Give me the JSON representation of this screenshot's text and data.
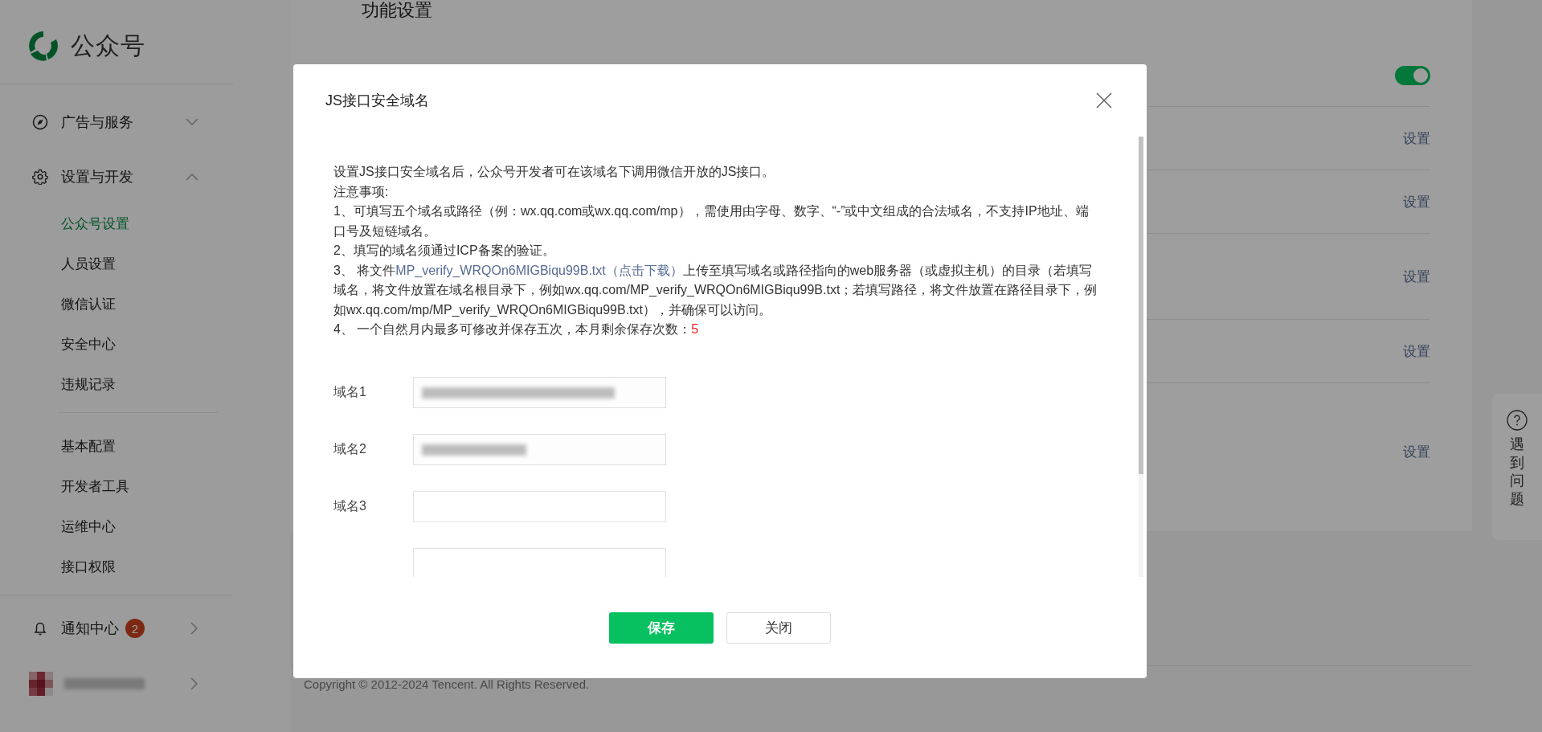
{
  "sidebar": {
    "brand": "公众号",
    "menus": [
      {
        "label": "广告与服务",
        "kind": "compass",
        "expanded": false
      },
      {
        "label": "设置与开发",
        "kind": "gear",
        "expanded": true,
        "groups": [
          {
            "items": [
              {
                "label": "公众号设置",
                "selected": true
              },
              {
                "label": "人员设置",
                "selected": false
              },
              {
                "label": "微信认证",
                "selected": false
              },
              {
                "label": "安全中心",
                "selected": false
              },
              {
                "label": "违规记录",
                "selected": false
              }
            ]
          },
          {
            "items": [
              {
                "label": "基本配置",
                "selected": false
              },
              {
                "label": "开发者工具",
                "selected": false
              },
              {
                "label": "运维中心",
                "selected": false
              },
              {
                "label": "接口权限",
                "selected": false
              }
            ]
          }
        ]
      }
    ],
    "notification": {
      "label": "通知中心",
      "badge": "2"
    }
  },
  "main": {
    "title": "功能设置",
    "rows": [
      {
        "kind": "toggle",
        "on": true
      },
      {
        "kind": "link",
        "label": "设置"
      },
      {
        "kind": "link",
        "label": "设置"
      },
      {
        "kind": "link",
        "label": "设置"
      },
      {
        "kind": "link",
        "label": "设置"
      },
      {
        "kind": "link",
        "label": "设置"
      }
    ],
    "footer": "Copyright © 2012-2024 Tencent. All Rights Reserved."
  },
  "help": {
    "label": "遇到问题"
  },
  "dialog": {
    "title": "JS接口安全域名",
    "intro": "设置JS接口安全域名后，公众号开发者可在该域名下调用微信开放的JS接口。",
    "notes_title": "注意事项:",
    "notes": [
      {
        "kind": "plain",
        "text": "1、可填写五个域名或路径（例：wx.qq.com或wx.qq.com/mp），需使用由字母、数字、“-”或中文组成的合法域名，不支持IP地址、端口号及短链域名。"
      },
      {
        "kind": "plain",
        "text": "2、填写的域名须通过ICP备案的验证。"
      },
      {
        "kind": "link",
        "before": "3、 将文件",
        "link": "MP_verify_WRQOn6MIGBiqu99B.txt（点击下载）",
        "after": "上传至填写域名或路径指向的web服务器（或虚拟主机）的目录（若填写域名，将文件放置在域名根目录下，例如wx.qq.com/MP_verify_WRQOn6MIGBiqu99B.txt；若填写路径，将文件放置在路径目录下，例如wx.qq.com/mp/MP_verify_WRQOn6MIGBiqu99B.txt），并确保可以访问。"
      },
      {
        "kind": "count",
        "text": "4、 一个自然月内最多可修改并保存五次，本月剩余保存次数：",
        "count": "5"
      }
    ],
    "fields": [
      {
        "kind": "input",
        "label": "域名1",
        "filled": true
      },
      {
        "kind": "input",
        "label": "域名2",
        "filled": true
      },
      {
        "kind": "input",
        "label": "域名3"
      },
      {
        "kind": "input"
      }
    ],
    "buttons": [
      {
        "label": "保存",
        "kind": "primary"
      },
      {
        "label": "关闭",
        "kind": "default"
      }
    ]
  }
}
